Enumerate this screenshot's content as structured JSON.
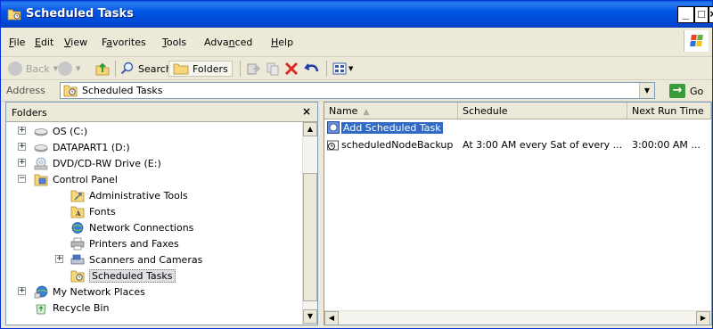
{
  "window": {
    "title": "Scheduled Tasks",
    "min_glyph": "_",
    "max_glyph": "□",
    "close_glyph": "×"
  },
  "menu": [
    {
      "pre": "",
      "key": "F",
      "post": "ile"
    },
    {
      "pre": "",
      "key": "E",
      "post": "dit"
    },
    {
      "pre": "",
      "key": "V",
      "post": "iew"
    },
    {
      "pre": "F",
      "key": "a",
      "post": "vorites"
    },
    {
      "pre": "",
      "key": "T",
      "post": "ools"
    },
    {
      "pre": "Adva",
      "key": "n",
      "post": "ced"
    },
    {
      "pre": "",
      "key": "H",
      "post": "elp"
    }
  ],
  "toolbar": {
    "back": "Back",
    "search": "Search",
    "folders": "Folders"
  },
  "address": {
    "label": "Address",
    "value": "Scheduled Tasks",
    "go": "Go"
  },
  "folders": {
    "title": "Folders",
    "close": "×",
    "items": [
      {
        "label": "OS (C:)"
      },
      {
        "label": "DATAPART1 (D:)"
      },
      {
        "label": "DVD/CD-RW Drive (E:)"
      },
      {
        "label": "Control Panel"
      },
      {
        "label": "Administrative Tools"
      },
      {
        "label": "Fonts"
      },
      {
        "label": "Network Connections"
      },
      {
        "label": "Printers and Faxes"
      },
      {
        "label": "Scanners and Cameras"
      },
      {
        "label": "Scheduled Tasks"
      },
      {
        "label": "My Network Places"
      },
      {
        "label": "Recycle Bin"
      }
    ]
  },
  "list": {
    "columns": [
      "Name",
      "Schedule",
      "Next Run Time"
    ],
    "rows": [
      {
        "name": "Add Scheduled Task",
        "schedule": "",
        "next": ""
      },
      {
        "name": "scheduledNodeBackup",
        "schedule": "At 3:00 AM every Sat of every ...",
        "next": "3:00:00 AM ..."
      }
    ]
  }
}
